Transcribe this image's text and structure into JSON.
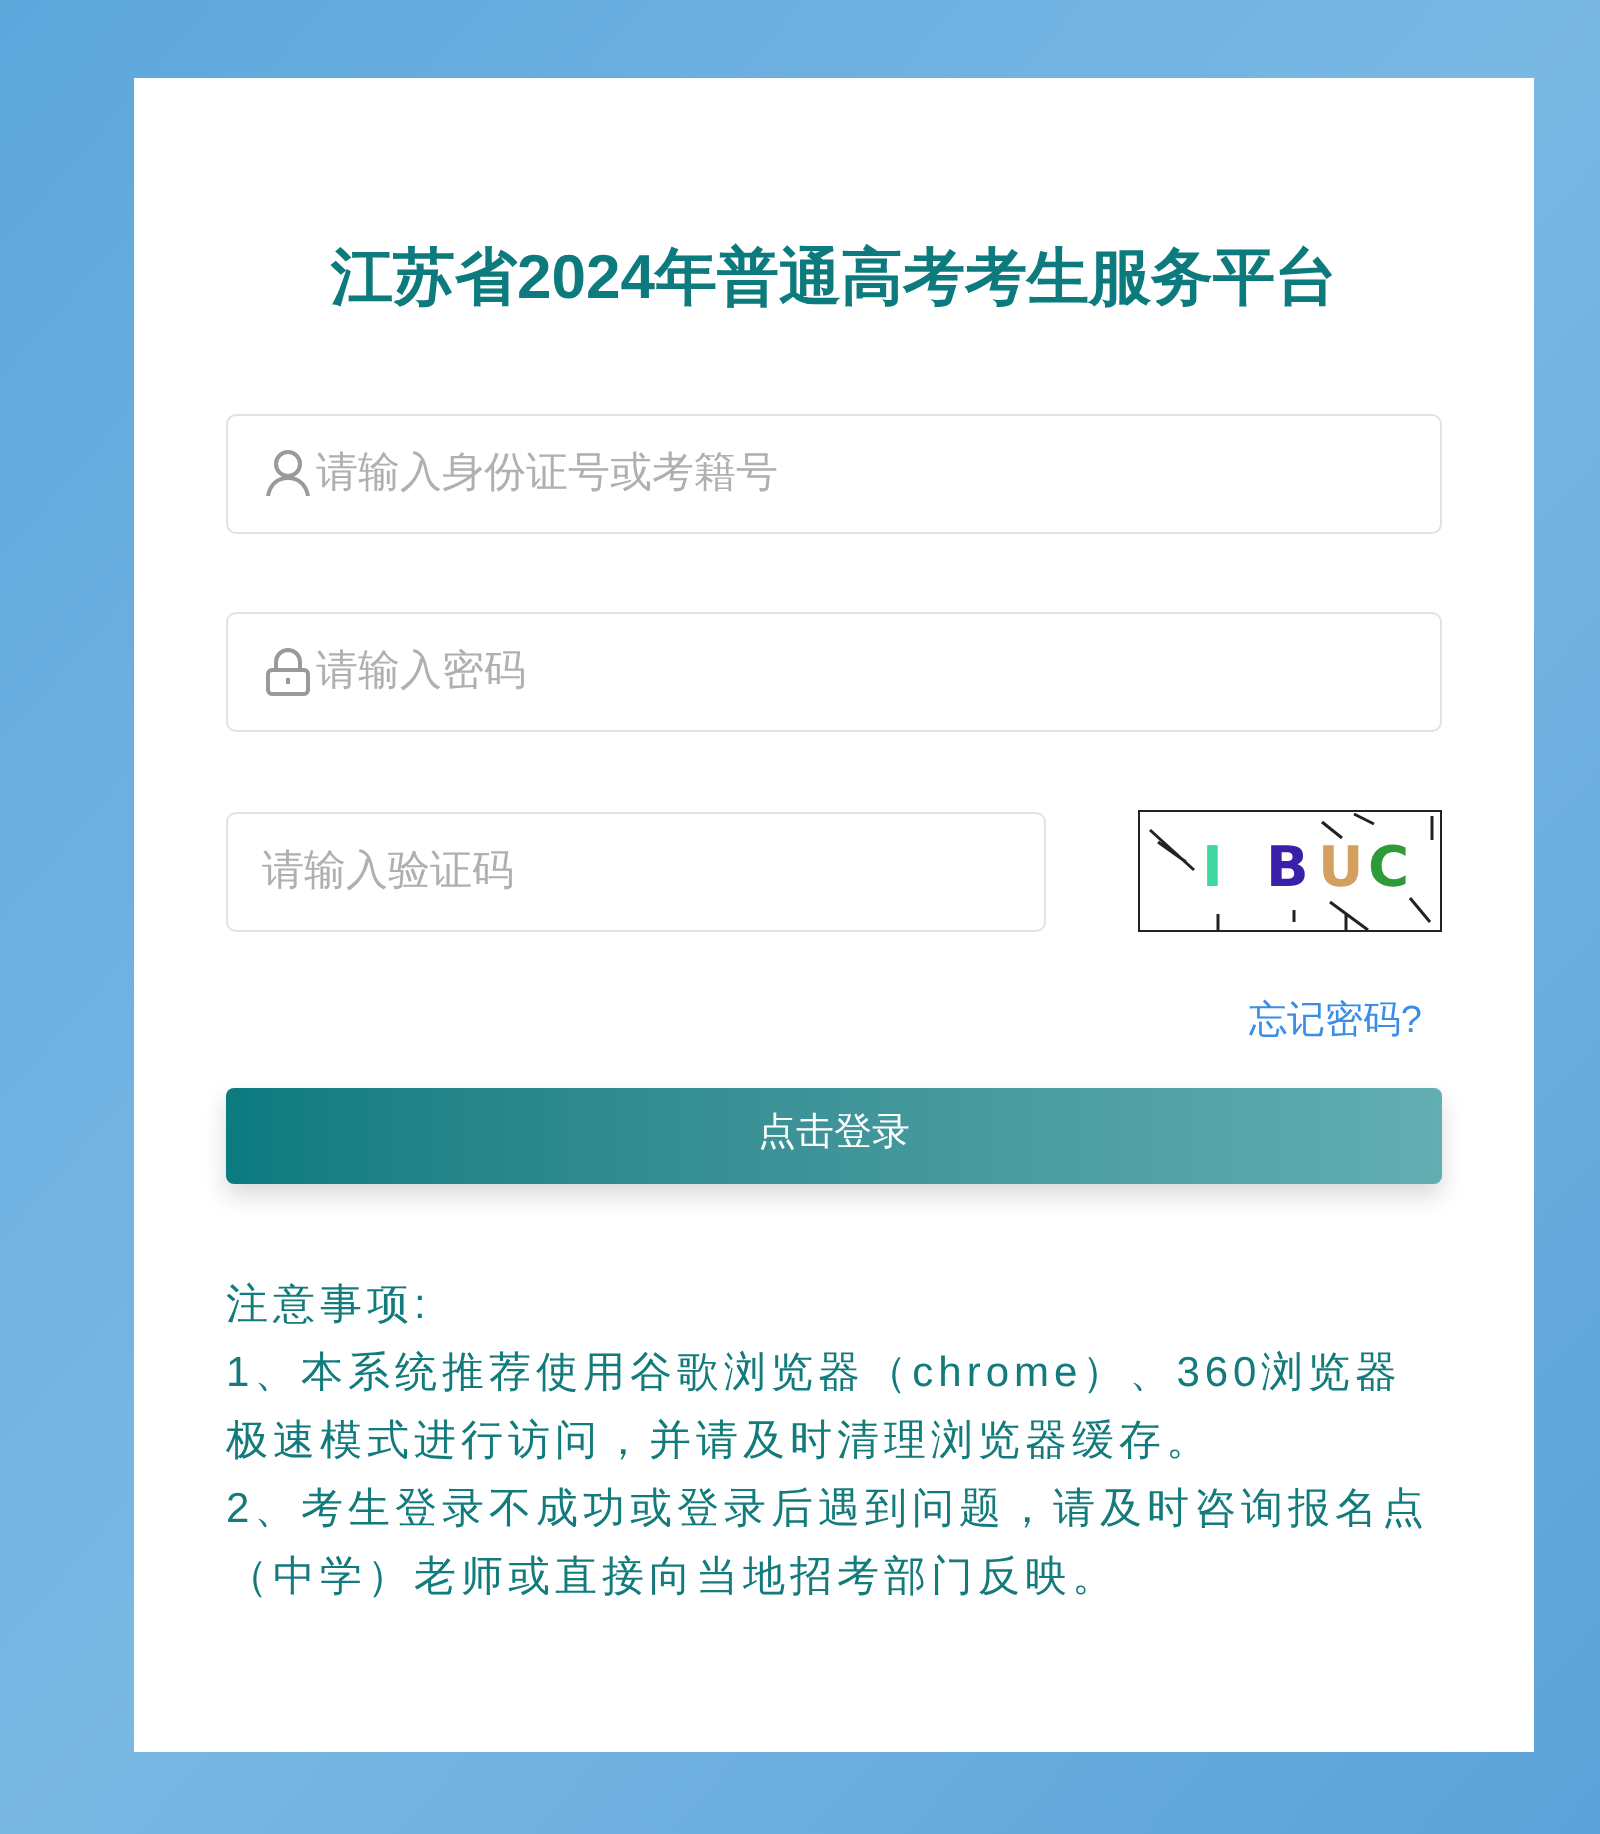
{
  "title": "江苏省2024年普通高考考生服务平台",
  "fields": [
    {
      "kind": "user",
      "placeholder": "请输入身份证号或考籍号"
    },
    {
      "kind": "lock",
      "placeholder": "请输入密码"
    }
  ],
  "captcha_field": {
    "placeholder": "请输入验证码"
  },
  "captcha": [
    {
      "char": "I",
      "color": "#3fd6a0"
    },
    {
      "char": "B",
      "color": "#3a1fa8"
    },
    {
      "char": "U",
      "color": "#d4a060"
    },
    {
      "char": "C",
      "color": "#2e9a3a"
    }
  ],
  "forgot_link": "忘记密码?",
  "login_button": "点击登录",
  "notes": {
    "heading": "注意事项:",
    "items": [
      "1、本系统推荐使用谷歌浏览器（chrome）、360浏览器极速模式进行访问，并请及时清理浏览器缓存。",
      "2、考生登录不成功或登录后遇到问题，请及时咨询报名点（中学）老师或直接向当地招考部门反映。"
    ]
  }
}
